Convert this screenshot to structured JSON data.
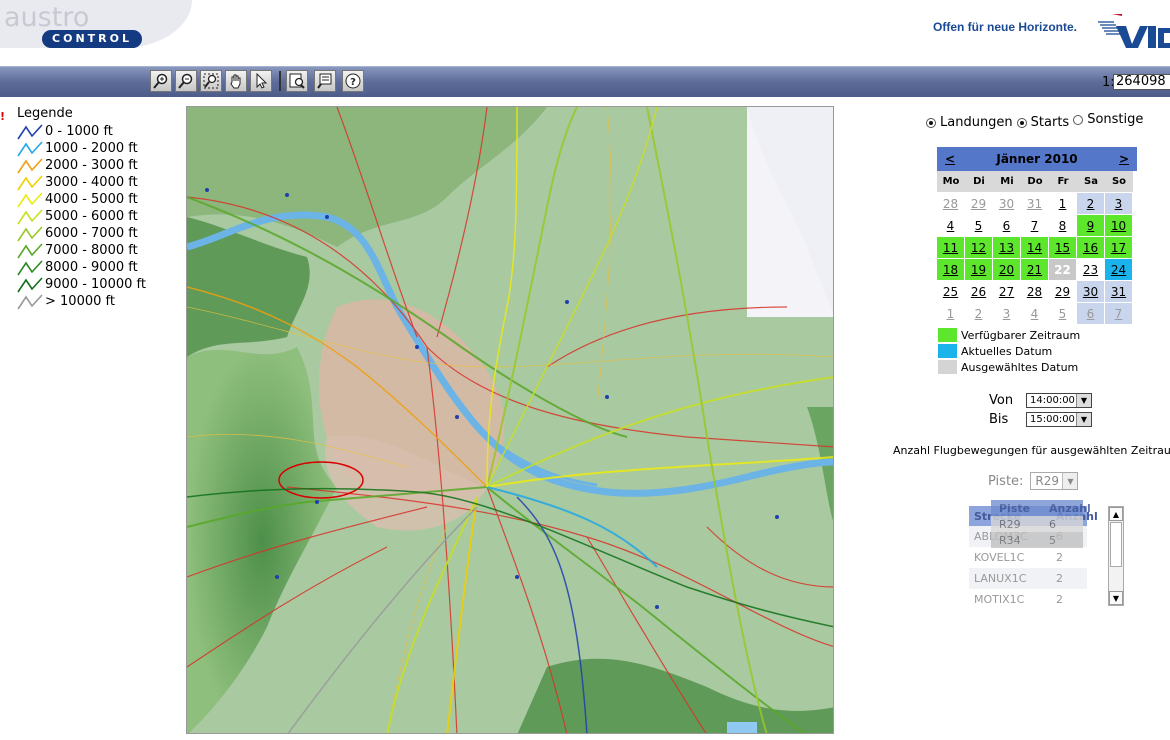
{
  "header": {
    "logo_word": "austro",
    "logo_sub": "CONTROL",
    "slogan": "Offen für neue Horizonte.",
    "partner_logo": "VIE"
  },
  "toolbar": {
    "tools": [
      "zoom-in-icon",
      "zoom-out-icon",
      "zoom-full-icon",
      "pan-hand-icon",
      "select-arrow-icon",
      "query-icon",
      "identify-icon",
      "help-icon"
    ],
    "scale_prefix": "1:",
    "scale_value": "264098"
  },
  "legend": {
    "marker": "!",
    "title": "Legende",
    "items": [
      {
        "label": "0 - 1000 ft",
        "color": "#1f3fb0"
      },
      {
        "label": "1000 - 2000 ft",
        "color": "#22a8e6"
      },
      {
        "label": "2000 - 3000 ft",
        "color": "#f0a010"
      },
      {
        "label": "3000 - 4000 ft",
        "color": "#f0d000"
      },
      {
        "label": "4000 - 5000 ft",
        "color": "#ecec10"
      },
      {
        "label": "5000 - 6000 ft",
        "color": "#c8e020"
      },
      {
        "label": "6000 - 7000 ft",
        "color": "#98c828"
      },
      {
        "label": "7000 - 8000 ft",
        "color": "#58a828"
      },
      {
        "label": "8000 - 9000 ft",
        "color": "#2d8a22"
      },
      {
        "label": "9000 - 10000 ft",
        "color": "#107018"
      },
      {
        "label": "> 10000 ft",
        "color": "#999999"
      }
    ]
  },
  "filter": {
    "options": [
      {
        "label": "Landungen",
        "checked": true
      },
      {
        "label": "Starts",
        "checked": true
      },
      {
        "label": "Sonstige",
        "checked": false
      }
    ]
  },
  "calendar": {
    "prev": "<",
    "next": ">",
    "title": "Jänner 2010",
    "weekdays": [
      "Mo",
      "Di",
      "Mi",
      "Do",
      "Fr",
      "Sa",
      "So"
    ],
    "weeks": [
      [
        {
          "d": "28",
          "t": "other"
        },
        {
          "d": "29",
          "t": "other"
        },
        {
          "d": "30",
          "t": "other"
        },
        {
          "d": "31",
          "t": "other"
        },
        {
          "d": "1",
          "t": "plain"
        },
        {
          "d": "2",
          "t": "wk"
        },
        {
          "d": "3",
          "t": "wk"
        }
      ],
      [
        {
          "d": "4",
          "t": "plain"
        },
        {
          "d": "5",
          "t": "plain"
        },
        {
          "d": "6",
          "t": "plain"
        },
        {
          "d": "7",
          "t": "plain"
        },
        {
          "d": "8",
          "t": "plain"
        },
        {
          "d": "9",
          "t": "avail"
        },
        {
          "d": "10",
          "t": "avail"
        }
      ],
      [
        {
          "d": "11",
          "t": "avail"
        },
        {
          "d": "12",
          "t": "avail"
        },
        {
          "d": "13",
          "t": "avail"
        },
        {
          "d": "14",
          "t": "avail"
        },
        {
          "d": "15",
          "t": "avail"
        },
        {
          "d": "16",
          "t": "avail"
        },
        {
          "d": "17",
          "t": "avail"
        }
      ],
      [
        {
          "d": "18",
          "t": "avail"
        },
        {
          "d": "19",
          "t": "avail"
        },
        {
          "d": "20",
          "t": "avail"
        },
        {
          "d": "21",
          "t": "avail"
        },
        {
          "d": "22",
          "t": "sel"
        },
        {
          "d": "23",
          "t": "plain"
        },
        {
          "d": "24",
          "t": "current"
        }
      ],
      [
        {
          "d": "25",
          "t": "plain"
        },
        {
          "d": "26",
          "t": "plain"
        },
        {
          "d": "27",
          "t": "plain"
        },
        {
          "d": "28",
          "t": "plain"
        },
        {
          "d": "29",
          "t": "plain"
        },
        {
          "d": "30",
          "t": "wk"
        },
        {
          "d": "31",
          "t": "wk"
        }
      ],
      [
        {
          "d": "1",
          "t": "other"
        },
        {
          "d": "2",
          "t": "other"
        },
        {
          "d": "3",
          "t": "other"
        },
        {
          "d": "4",
          "t": "other"
        },
        {
          "d": "5",
          "t": "other"
        },
        {
          "d": "6",
          "t": "otherwk"
        },
        {
          "d": "7",
          "t": "otherwk"
        }
      ]
    ],
    "legend": [
      {
        "label": "Verfügbarer Zeitraum",
        "color": "#5ce62c"
      },
      {
        "label": "Aktuelles Datum",
        "color": "#1ab3ec"
      },
      {
        "label": "Ausgewähltes Datum",
        "color": "#d4d4d4"
      }
    ]
  },
  "time": {
    "from_label": "Von",
    "from_value": "14:00:00",
    "to_label": "Bis",
    "to_value": "15:00:00"
  },
  "movements": {
    "title": "Anzahl Flugbewegungen für ausgewählten Zeitrau",
    "piste_label": "Piste:",
    "piste_value": "R29",
    "route_table": {
      "headers": [
        "Strecke",
        "Anzahl"
      ],
      "rows": [
        [
          "ABLOM3C",
          "6"
        ],
        [
          "KOVEL1C",
          "2"
        ],
        [
          "LANUX1C",
          "2"
        ],
        [
          "MOTIX1C",
          "2"
        ]
      ]
    },
    "piste_table": {
      "headers": [
        "Piste",
        "Anzahl"
      ],
      "rows": [
        [
          "R29",
          "6"
        ],
        [
          "R34",
          "5"
        ]
      ]
    }
  }
}
